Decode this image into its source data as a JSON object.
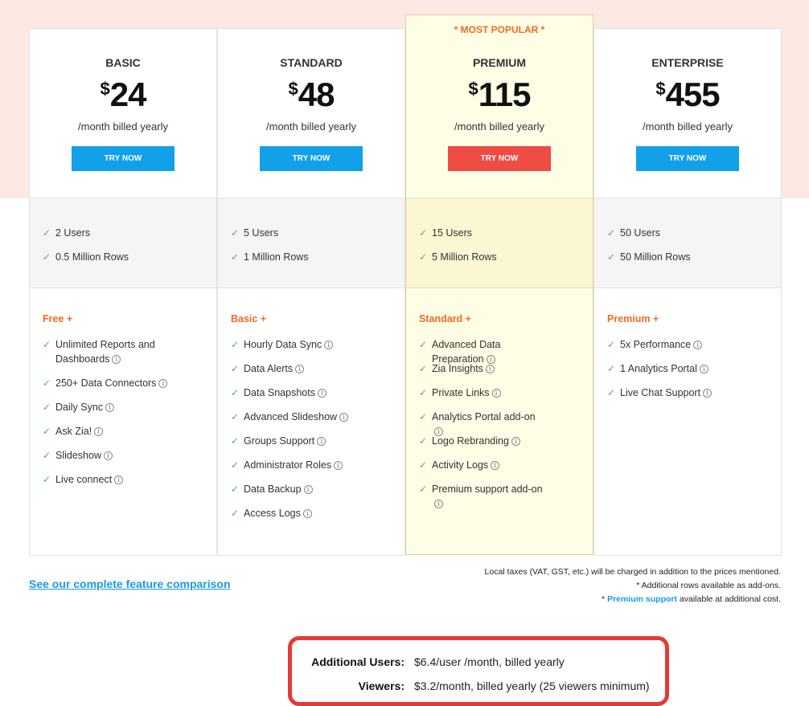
{
  "colors": {
    "accent_blue": "#12a0e8",
    "accent_red": "#ef4c43",
    "orange": "#f26b21",
    "check": "#4caf7d",
    "highlight_bg": "#fefde6",
    "box_border": "#e53935"
  },
  "plans": [
    {
      "name": "BASIC",
      "currency": "$",
      "price": "24",
      "period": "/month billed yearly",
      "button": "TRY NOW",
      "limits": [
        "2 Users",
        "0.5 Million Rows"
      ],
      "base": "Free +",
      "features": [
        "Unlimited Reports and Dashboards",
        "250+ Data Connectors",
        "Daily Sync",
        "Ask Zia!",
        "Slideshow",
        "Live connect"
      ]
    },
    {
      "name": "STANDARD",
      "currency": "$",
      "price": "48",
      "period": "/month billed yearly",
      "button": "TRY NOW",
      "limits": [
        "5 Users",
        "1 Million Rows"
      ],
      "base": "Basic +",
      "features": [
        "Hourly Data Sync",
        "Data Alerts",
        "Data Snapshots",
        "Advanced Slideshow",
        "Groups Support",
        "Administrator Roles",
        "Data Backup",
        "Access Logs"
      ]
    },
    {
      "badge": "* MOST POPULAR *",
      "name": "PREMIUM",
      "currency": "$",
      "price": "115",
      "period": "/month billed yearly",
      "button": "TRY NOW",
      "limits": [
        "15 Users",
        "5 Million Rows"
      ],
      "base": "Standard +",
      "features": [
        "Advanced Data Preparation",
        "Zia Insights",
        "Private Links",
        "Analytics Portal add-on",
        "Logo Rebranding",
        "Activity Logs",
        "Premium support add-on"
      ]
    },
    {
      "name": "ENTERPRISE",
      "currency": "$",
      "price": "455",
      "period": "/month billed yearly",
      "button": "TRY NOW",
      "limits": [
        "50 Users",
        "50 Million Rows"
      ],
      "base": "Premium +",
      "features": [
        "5x Performance",
        "1 Analytics Portal",
        "Live Chat Support"
      ]
    }
  ],
  "compare_link": "See our complete feature comparison",
  "notes": {
    "taxes": "Local taxes (VAT, GST, etc.) will be charged in addition to the prices mentioned.",
    "rows": "* Additional rows available as add-ons.",
    "support_prefix": "* ",
    "support_link": "Premium support",
    "support_suffix": " available at additional cost."
  },
  "addons": [
    {
      "label": "Additional Users:",
      "value": "$6.4/user /month, billed yearly"
    },
    {
      "label": "Viewers:",
      "value": "$3.2/month, billed yearly (25 viewers minimum)"
    }
  ]
}
